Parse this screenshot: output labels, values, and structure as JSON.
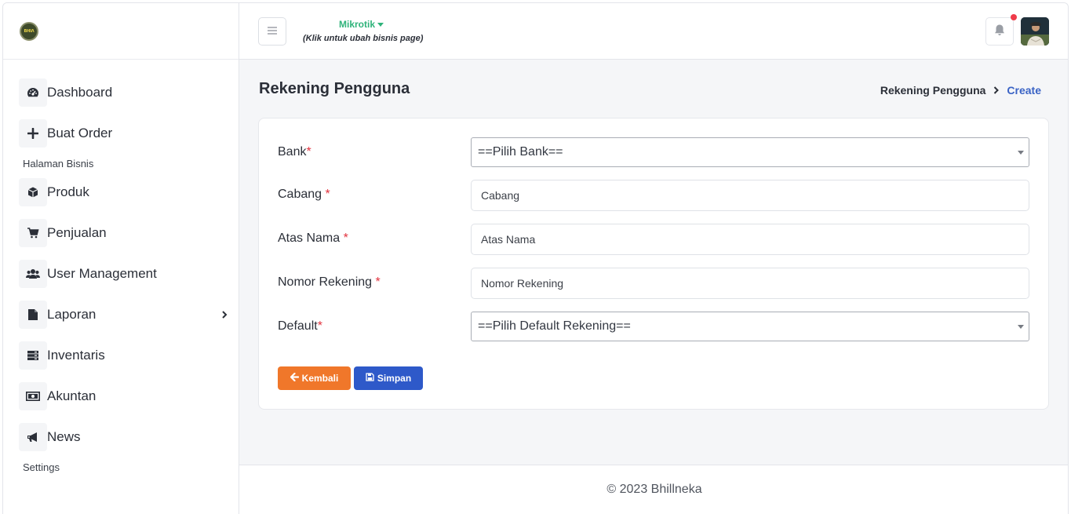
{
  "sidebar": {
    "logo_text": "ΒΗΙΛ",
    "items": [
      {
        "label": "Dashboard",
        "icon": "dashboard-icon"
      },
      {
        "label": "Buat Order",
        "icon": "plus-icon"
      },
      {
        "label": "Produk",
        "icon": "box-icon"
      },
      {
        "label": "Penjualan",
        "icon": "cart-icon"
      },
      {
        "label": "User Management",
        "icon": "users-icon"
      },
      {
        "label": "Laporan",
        "icon": "file-icon"
      },
      {
        "label": "Inventaris",
        "icon": "server-icon"
      },
      {
        "label": "Akuntan",
        "icon": "money-icon"
      },
      {
        "label": "News",
        "icon": "bullhorn-icon"
      }
    ],
    "sections": {
      "business": "Halaman Bisnis",
      "settings": "Settings"
    }
  },
  "topbar": {
    "business_name": "Mikrotik",
    "business_hint": "(Klik untuk ubah bisnis page)",
    "notification_dot_color": "#ef3b4a"
  },
  "page": {
    "title": "Rekening Pengguna",
    "breadcrumb": {
      "root": "Rekening Pengguna",
      "current": "Create"
    }
  },
  "form": {
    "bank": {
      "label": "Bank",
      "required_mark": "*",
      "selected": "==Pilih Bank=="
    },
    "cabang": {
      "label": "Cabang",
      "required_mark": "*",
      "placeholder": "Cabang"
    },
    "atas_nama": {
      "label": "Atas Nama",
      "required_mark": "*",
      "placeholder": "Atas Nama"
    },
    "nomor_rekening": {
      "label": "Nomor Rekening",
      "required_mark": "*",
      "placeholder": "Nomor Rekening"
    },
    "default": {
      "label": "Default",
      "required_mark": "*",
      "selected": "==Pilih Default Rekening=="
    },
    "back_label": "Kembali",
    "save_label": "Simpan"
  },
  "footer": {
    "text": "© 2023 Bhillneka"
  },
  "colors": {
    "accent": "#2fb37a",
    "primary": "#2e59c9",
    "warning": "#f0772a",
    "link": "#3a63c5",
    "required": "#e2333f"
  }
}
